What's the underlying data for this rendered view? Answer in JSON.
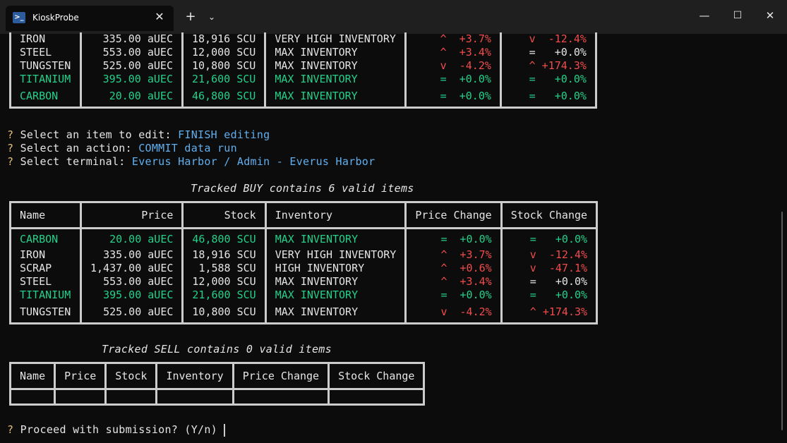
{
  "window": {
    "tab_title": "KioskProbe",
    "tab_icon": "powershell-icon",
    "controls": [
      "minimize",
      "maximize",
      "close"
    ]
  },
  "top_table_rows": [
    {
      "name": "IRON",
      "price": "335.00 aUEC",
      "stock": "18,916 SCU",
      "inventory": "VERY HIGH INVENTORY",
      "price_change": "^  +3.7%",
      "stock_change": "v  -12.4%",
      "color": "white"
    },
    {
      "name": "STEEL",
      "price": "553.00 aUEC",
      "stock": "12,000 SCU",
      "inventory": "MAX INVENTORY",
      "price_change": "^  +3.4%",
      "stock_change": "=   +0.0%",
      "color": "white"
    },
    {
      "name": "TUNGSTEN",
      "price": "525.00 aUEC",
      "stock": "10,800 SCU",
      "inventory": "MAX INVENTORY",
      "price_change": "v  -4.2%",
      "stock_change": "^ +174.3%",
      "color": "white"
    },
    {
      "name": "TITANIUM",
      "price": "395.00 aUEC",
      "stock": "21,600 SCU",
      "inventory": "MAX INVENTORY",
      "price_change": "=  +0.0%",
      "stock_change": "=   +0.0%",
      "color": "green"
    },
    {
      "name": "CARBON",
      "price": "20.00 aUEC",
      "stock": "46,800 SCU",
      "inventory": "MAX INVENTORY",
      "price_change": "=  +0.0%",
      "stock_change": "=   +0.0%",
      "color": "green"
    }
  ],
  "prompts": [
    {
      "q": "?",
      "label": "Select an item to edit:",
      "value": "FINISH editing"
    },
    {
      "q": "?",
      "label": "Select an action:",
      "value": "COMMIT data run"
    },
    {
      "q": "?",
      "label": "Select terminal:",
      "value": "Everus Harbor / Admin - Everus Harbor"
    }
  ],
  "buy": {
    "title": "Tracked BUY contains 6 valid items",
    "headers": [
      "Name",
      "Price",
      "Stock",
      "Inventory",
      "Price Change",
      "Stock Change"
    ],
    "rows": [
      {
        "name": "CARBON",
        "price": "20.00 aUEC",
        "stock": "46,800 SCU",
        "inventory": "MAX INVENTORY",
        "price_change": "=  +0.0%",
        "stock_change": "=   +0.0%",
        "color": "green"
      },
      {
        "name": "IRON",
        "price": "335.00 aUEC",
        "stock": "18,916 SCU",
        "inventory": "VERY HIGH INVENTORY",
        "price_change": "^  +3.7%",
        "stock_change": "v  -12.4%",
        "color": "white"
      },
      {
        "name": "SCRAP",
        "price": "1,437.00 aUEC",
        "stock": "1,588 SCU",
        "inventory": "HIGH INVENTORY",
        "price_change": "^  +0.6%",
        "stock_change": "v  -47.1%",
        "color": "white"
      },
      {
        "name": "STEEL",
        "price": "553.00 aUEC",
        "stock": "12,000 SCU",
        "inventory": "MAX INVENTORY",
        "price_change": "^  +3.4%",
        "stock_change": "=   +0.0%",
        "color": "white"
      },
      {
        "name": "TITANIUM",
        "price": "395.00 aUEC",
        "stock": "21,600 SCU",
        "inventory": "MAX INVENTORY",
        "price_change": "=  +0.0%",
        "stock_change": "=   +0.0%",
        "color": "green"
      },
      {
        "name": "TUNGSTEN",
        "price": "525.00 aUEC",
        "stock": "10,800 SCU",
        "inventory": "MAX INVENTORY",
        "price_change": "v  -4.2%",
        "stock_change": "^ +174.3%",
        "color": "white"
      }
    ]
  },
  "sell": {
    "title": "Tracked SELL contains 0 valid items",
    "headers": [
      "Name",
      "Price",
      "Stock",
      "Inventory",
      "Price Change",
      "Stock Change"
    ]
  },
  "final_prompt": {
    "q": "?",
    "label": "Proceed with submission? (Y/n)"
  },
  "colors": {
    "background": "#0c0c0c",
    "text": "#cccccc",
    "green": "#23d18b",
    "red": "#f14c4c",
    "highlight": "#61afef",
    "question": "#e5c07b"
  }
}
